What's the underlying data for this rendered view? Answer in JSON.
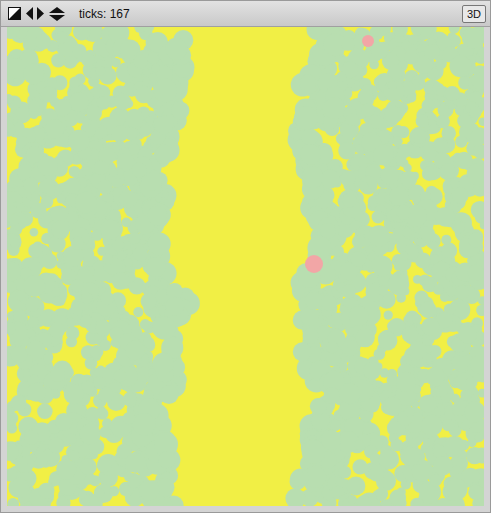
{
  "view": {
    "ticks": "ticks: 167",
    "buttons": [
      {
        "label": "3D"
      }
    ],
    "agents": [
      {
        "name": "pink-turtle",
        "color": "#f2a6a6"
      },
      {
        "name": "pink-turtle",
        "color": "#f2a6a6"
      }
    ]
  }
}
